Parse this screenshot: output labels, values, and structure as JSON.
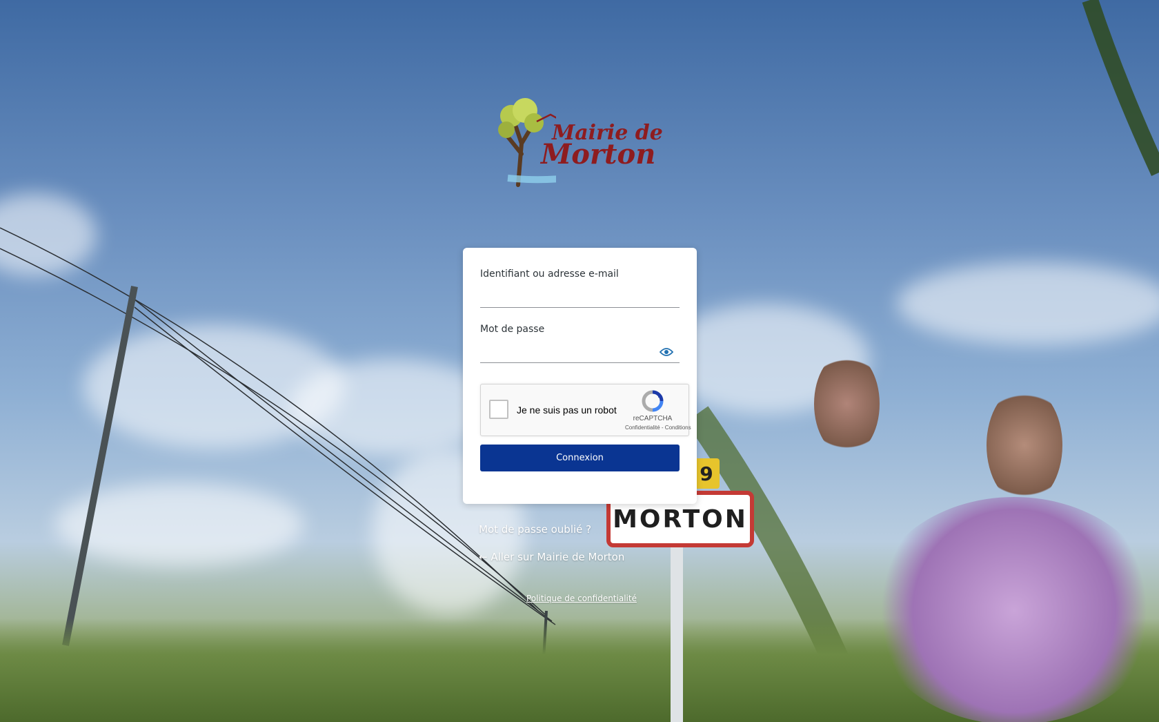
{
  "logo": {
    "line1": "Mairie de",
    "line2": "Morton",
    "icon": "tree-house-icon"
  },
  "background": {
    "road_sign": "MORTON",
    "road_sign_number": "9"
  },
  "form": {
    "username_label": "Identifiant ou adresse e-mail",
    "username_value": "",
    "password_label": "Mot de passe",
    "password_value": "",
    "show_password_icon": "eye-icon",
    "captcha": {
      "label": "Je ne suis pas un robot",
      "brand": "reCAPTCHA",
      "links": "Confidentialité - Conditions"
    },
    "submit_label": "Connexion"
  },
  "links": {
    "lost_password": "Mot de passe oublié ?",
    "back_to_site": "← Aller sur Mairie de Morton",
    "privacy": "Politique de confidentialité"
  },
  "colors": {
    "primary_button": "#0a3592",
    "eye_icon": "#2271b1",
    "logo_red": "#8e1c1f"
  }
}
